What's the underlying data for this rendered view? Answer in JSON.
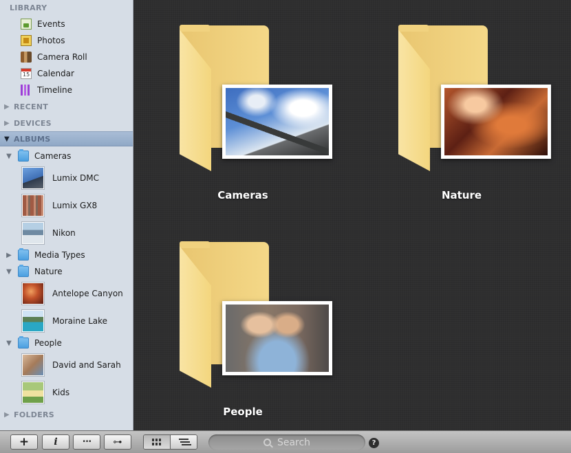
{
  "sidebar": {
    "library": {
      "label": "LIBRARY",
      "items": [
        {
          "label": "Events",
          "icon": "events-icon"
        },
        {
          "label": "Photos",
          "icon": "photos-icon"
        },
        {
          "label": "Camera Roll",
          "icon": "camera-roll-icon"
        },
        {
          "label": "Calendar",
          "icon": "calendar-icon"
        },
        {
          "label": "Timeline",
          "icon": "timeline-icon"
        }
      ]
    },
    "recent": {
      "label": "RECENT"
    },
    "devices": {
      "label": "DEVICES"
    },
    "albums": {
      "label": "ALBUMS",
      "groups": [
        {
          "label": "Cameras",
          "expanded": true,
          "items": [
            "Lumix DMC",
            "Lumix GX8",
            "Nikon"
          ]
        },
        {
          "label": "Media Types",
          "expanded": false,
          "items": []
        },
        {
          "label": "Nature",
          "expanded": true,
          "items": [
            "Antelope Canyon",
            "Moraine Lake"
          ]
        },
        {
          "label": "People",
          "expanded": true,
          "items": [
            "David and Sarah",
            "Kids"
          ]
        }
      ]
    },
    "folders": {
      "label": "FOLDERS"
    }
  },
  "main": {
    "albums": [
      {
        "label": "Cameras"
      },
      {
        "label": "Nature"
      },
      {
        "label": "People"
      }
    ]
  },
  "toolbar": {
    "add_label": "+",
    "info_label": "i",
    "more_label": "•••",
    "key_label": "⊶",
    "search_placeholder": "Search",
    "help_label": "?"
  },
  "colors": {
    "sidebar_bg": "#d6dde6",
    "selection": "#9fb4cf",
    "main_bg": "#2c2c2d",
    "folder": "#f4d888"
  }
}
